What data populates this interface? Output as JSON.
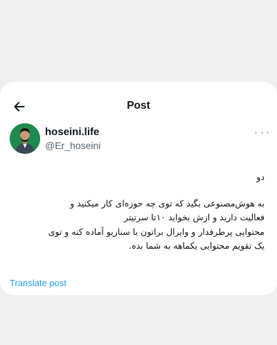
{
  "header": {
    "title": "Post",
    "back_icon": "arrow-left-icon"
  },
  "author": {
    "display_name": "hoseini.life",
    "handle": "@Er_hoseini",
    "avatar_bg": "#1f8a4d"
  },
  "more_icon": "more-horizontal-icon",
  "post": {
    "line1": "دو",
    "line2": "به هوش‌مصنوعی بگید که توی چه حوزه‌ای کار میکنید و",
    "line3": "فعالیت دارید و ازش بخواید ۱۰تا سرتیتر",
    "line4": "محتوایی پرطرفدار و وایرال براتون با سناریو آماده کنه و توی",
    "line5": "یک تقویم محتوایی یکماهه به شما بده."
  },
  "translate_label": "Translate post",
  "colors": {
    "page_bg": "#efefef",
    "card_bg": "#ffffff",
    "link": "#1d9bf0",
    "muted": "#536471"
  }
}
